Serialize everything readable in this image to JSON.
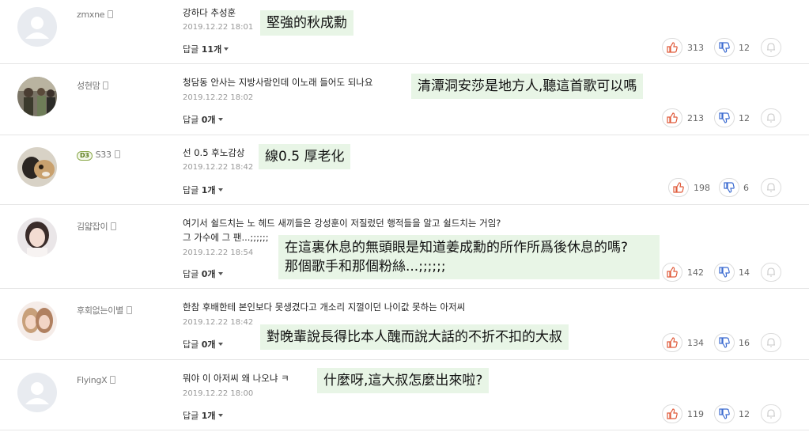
{
  "reply_unit": "개",
  "comments": [
    {
      "username": "zmxne",
      "text": "강하다 추성훈",
      "date": "2019.12.22  18:01",
      "reply_label": "답글",
      "reply_count": "11",
      "translation": "堅強的秋成勳",
      "likes": "313",
      "dislikes": "12",
      "badge": ""
    },
    {
      "username": "성현맘",
      "text": "청담동 안사는 지방사람인데 이노래 들어도 되나요",
      "date": "2019.12.22  18:02",
      "reply_label": "답글",
      "reply_count": "0",
      "translation": "清潭洞安莎是地方人,聽這首歌可以嗎",
      "likes": "213",
      "dislikes": "12",
      "badge": ""
    },
    {
      "username": "S33",
      "text": "선 0.5 후노감상",
      "date": "2019.12.22  18:42",
      "reply_label": "답글",
      "reply_count": "1",
      "translation": "線0.5 厚老化",
      "likes": "198",
      "dislikes": "6",
      "badge": "D3"
    },
    {
      "username": "김얇잡이",
      "text": "여기서 쉴드치는 노 헤드 새끼들은 강성훈이 저질렀던 행적들을 알고 쉴드치는 거임?",
      "text2": "그 가수에 그 팬...;;;;;;",
      "date": "2019.12.22  18:54",
      "reply_label": "답글",
      "reply_count": "0",
      "translation": "在這裏休息的無頭眼是知道姜成勳的所作所爲後休息的嗎?",
      "translation2": "那個歌手和那個粉絲...;;;;;;",
      "likes": "142",
      "dislikes": "14",
      "badge": ""
    },
    {
      "username": "후회없는이별",
      "text": "한참 후배한테 본인보다 못생겼다고 개소리 지껄이던 나이값 못하는 아저씨",
      "date": "2019.12.22  18:42",
      "reply_label": "답글",
      "reply_count": "0",
      "translation": "對晚輩說長得比本人醜而說大話的不折不扣的大叔",
      "likes": "134",
      "dislikes": "16",
      "badge": ""
    },
    {
      "username": "FlyingX",
      "text": "뭐야 이 아저씨 왜 나오냐 ㅋ",
      "date": "2019.12.22  18:00",
      "reply_label": "답글",
      "reply_count": "1",
      "translation": "什麼呀,這大叔怎麼出來啦?",
      "likes": "119",
      "dislikes": "12",
      "badge": ""
    }
  ]
}
